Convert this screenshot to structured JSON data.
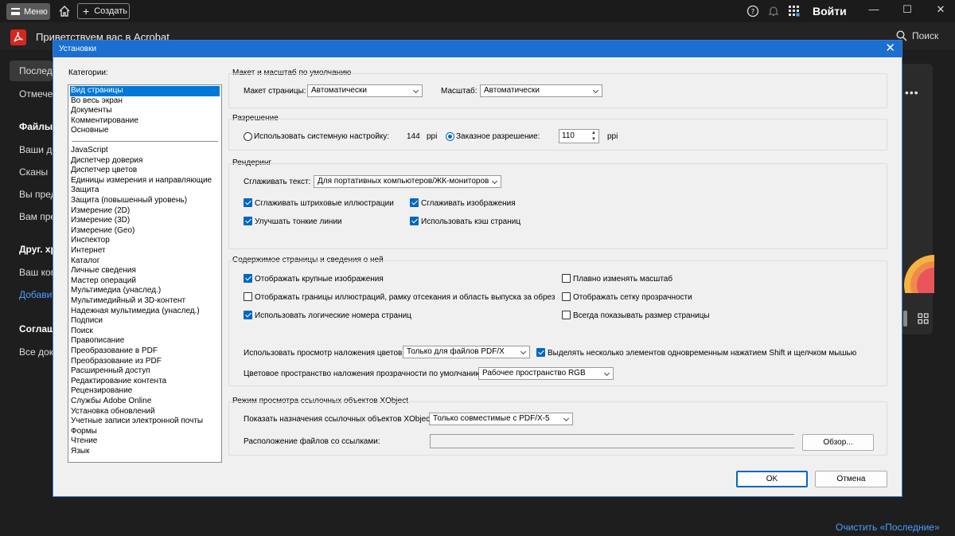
{
  "app": {
    "menu_label": "Меню",
    "create_label": "Создать",
    "login_label": "Войти",
    "title": "Приветствуем вас в Acrobat",
    "search_label": "Поиск",
    "icons": [
      "home-icon",
      "help-icon",
      "bell-icon",
      "apps-grid-icon",
      "search-icon"
    ],
    "window_controls": {
      "minimize": "—",
      "maximize": "☐",
      "close": "✕"
    }
  },
  "sidebar": {
    "items": [
      {
        "label": "Последние",
        "style": "sel"
      },
      {
        "label": "Отмеченные",
        "style": ""
      },
      {
        "label": "Файлы",
        "style": "bold"
      },
      {
        "label": "Ваши документы",
        "style": ""
      },
      {
        "label": "Сканы",
        "style": ""
      },
      {
        "label": "Вы предоставили",
        "style": ""
      },
      {
        "label": "Вам предоставили",
        "style": ""
      },
      {
        "label": "Друг. хранилища",
        "style": "bold"
      },
      {
        "label": "Ваш компьютер",
        "style": ""
      },
      {
        "label": "Добавить",
        "style": "link"
      },
      {
        "label": "Соглашения",
        "style": "bold"
      },
      {
        "label": "Все документы",
        "style": ""
      }
    ]
  },
  "right": {
    "dots": "•••",
    "clear_link": "Очистить «Последние»"
  },
  "dialog": {
    "title": "Установки",
    "close_glyph": "✕",
    "categories_label": "Категории:",
    "categories_top": [
      "Вид страницы",
      "Во весь экран",
      "Документы",
      "Комментирование",
      "Основные"
    ],
    "categories_bottom": [
      "JavaScript",
      "Диспетчер доверия",
      "Диспетчер цветов",
      "Единицы измерения и направляющие",
      "Защита",
      "Защита (повышенный уровень)",
      "Измерение (2D)",
      "Измерение (3D)",
      "Измерение (Geo)",
      "Инспектор",
      "Интернет",
      "Каталог",
      "Личные сведения",
      "Мастер операций",
      "Мультимедиа (унаслед.)",
      "Мультимедийный и 3D-контент",
      "Надежная мультимедиа (унаслед.)",
      "Подписи",
      "Поиск",
      "Правописание",
      "Преобразование в PDF",
      "Преобразование из PDF",
      "Расширенный доступ",
      "Редактирование контента",
      "Рецензирование",
      "Службы Adobe Online",
      "Установка обновлений",
      "Учетные записи электронной почты",
      "Формы",
      "Чтение",
      "Язык"
    ],
    "layout": {
      "title": "Макет и масштаб по умолчанию",
      "layout_label": "Макет страницы:",
      "layout_value": "Автоматически",
      "zoom_label": "Масштаб:",
      "zoom_value": "Автоматически"
    },
    "resolution": {
      "title": "Разрешение",
      "system_label": "Использовать системную настройку:",
      "system_value": "144",
      "system_unit": "ppi",
      "custom_label": "Заказное разрешение:",
      "custom_value": "110",
      "custom_unit": "ppi",
      "selected": "custom"
    },
    "rendering": {
      "title": "Рендеринг",
      "smooth_text_label": "Сглаживать текст:",
      "smooth_text_value": "Для портативных компьютеров/ЖК-мониторов",
      "options": [
        {
          "label": "Сглаживать штриховые иллюстрации",
          "checked": true
        },
        {
          "label": "Сглаживать изображения",
          "checked": true
        },
        {
          "label": "Улучшать тонкие линии",
          "checked": true
        },
        {
          "label": "Использовать кэш страниц",
          "checked": true
        }
      ]
    },
    "content": {
      "title": "Содержимое страницы и сведения о ней",
      "options": [
        {
          "label": "Отображать крупные изображения",
          "checked": true
        },
        {
          "label": "Плавно изменять масштаб",
          "checked": false
        },
        {
          "label": "Отображать границы иллюстраций, рамку отсекания и область выпуска за обрез",
          "checked": false
        },
        {
          "label": "Отображать сетку прозрачности",
          "checked": false
        },
        {
          "label": "Использовать логические номера страниц",
          "checked": true
        },
        {
          "label": "Всегда показывать размер страницы",
          "checked": false
        }
      ],
      "overprint_label": "Использовать просмотр наложения цветов:",
      "overprint_value": "Только для файлов PDF/X",
      "multi_select_label": "Выделять несколько элементов одновременным нажатием Shift и щелчком мышью",
      "multi_select_checked": true,
      "blend_label": "Цветовое пространство наложения прозрачности по умолчанию:",
      "blend_value": "Рабочее пространство RGB"
    },
    "xobject": {
      "title": "Режим просмотра ссылочных объектов XObject",
      "show_label": "Показать назначения ссылочных объектов XObject:",
      "show_value": "Только совместимые с PDF/X-5",
      "location_label": "Расположение файлов со ссылками:",
      "location_value": "",
      "browse_label": "Обзор..."
    },
    "ok_label": "OK",
    "cancel_label": "Отмена"
  }
}
